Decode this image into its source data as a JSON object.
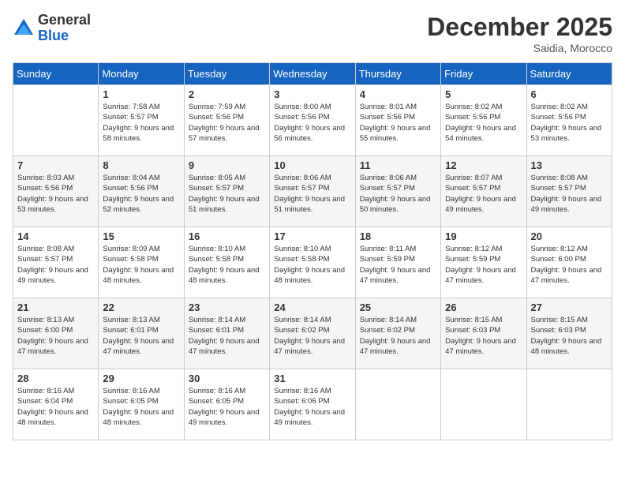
{
  "header": {
    "logo_general": "General",
    "logo_blue": "Blue",
    "month_year": "December 2025",
    "location": "Saidia, Morocco"
  },
  "days_of_week": [
    "Sunday",
    "Monday",
    "Tuesday",
    "Wednesday",
    "Thursday",
    "Friday",
    "Saturday"
  ],
  "weeks": [
    [
      {
        "day": "",
        "sunrise": "",
        "sunset": "",
        "daylight": ""
      },
      {
        "day": "1",
        "sunrise": "Sunrise: 7:58 AM",
        "sunset": "Sunset: 5:57 PM",
        "daylight": "Daylight: 9 hours and 58 minutes."
      },
      {
        "day": "2",
        "sunrise": "Sunrise: 7:59 AM",
        "sunset": "Sunset: 5:56 PM",
        "daylight": "Daylight: 9 hours and 57 minutes."
      },
      {
        "day": "3",
        "sunrise": "Sunrise: 8:00 AM",
        "sunset": "Sunset: 5:56 PM",
        "daylight": "Daylight: 9 hours and 56 minutes."
      },
      {
        "day": "4",
        "sunrise": "Sunrise: 8:01 AM",
        "sunset": "Sunset: 5:56 PM",
        "daylight": "Daylight: 9 hours and 55 minutes."
      },
      {
        "day": "5",
        "sunrise": "Sunrise: 8:02 AM",
        "sunset": "Sunset: 5:56 PM",
        "daylight": "Daylight: 9 hours and 54 minutes."
      },
      {
        "day": "6",
        "sunrise": "Sunrise: 8:02 AM",
        "sunset": "Sunset: 5:56 PM",
        "daylight": "Daylight: 9 hours and 53 minutes."
      }
    ],
    [
      {
        "day": "7",
        "sunrise": "Sunrise: 8:03 AM",
        "sunset": "Sunset: 5:56 PM",
        "daylight": "Daylight: 9 hours and 53 minutes."
      },
      {
        "day": "8",
        "sunrise": "Sunrise: 8:04 AM",
        "sunset": "Sunset: 5:56 PM",
        "daylight": "Daylight: 9 hours and 52 minutes."
      },
      {
        "day": "9",
        "sunrise": "Sunrise: 8:05 AM",
        "sunset": "Sunset: 5:57 PM",
        "daylight": "Daylight: 9 hours and 51 minutes."
      },
      {
        "day": "10",
        "sunrise": "Sunrise: 8:06 AM",
        "sunset": "Sunset: 5:57 PM",
        "daylight": "Daylight: 9 hours and 51 minutes."
      },
      {
        "day": "11",
        "sunrise": "Sunrise: 8:06 AM",
        "sunset": "Sunset: 5:57 PM",
        "daylight": "Daylight: 9 hours and 50 minutes."
      },
      {
        "day": "12",
        "sunrise": "Sunrise: 8:07 AM",
        "sunset": "Sunset: 5:57 PM",
        "daylight": "Daylight: 9 hours and 49 minutes."
      },
      {
        "day": "13",
        "sunrise": "Sunrise: 8:08 AM",
        "sunset": "Sunset: 5:57 PM",
        "daylight": "Daylight: 9 hours and 49 minutes."
      }
    ],
    [
      {
        "day": "14",
        "sunrise": "Sunrise: 8:08 AM",
        "sunset": "Sunset: 5:57 PM",
        "daylight": "Daylight: 9 hours and 49 minutes."
      },
      {
        "day": "15",
        "sunrise": "Sunrise: 8:09 AM",
        "sunset": "Sunset: 5:58 PM",
        "daylight": "Daylight: 9 hours and 48 minutes."
      },
      {
        "day": "16",
        "sunrise": "Sunrise: 8:10 AM",
        "sunset": "Sunset: 5:58 PM",
        "daylight": "Daylight: 9 hours and 48 minutes."
      },
      {
        "day": "17",
        "sunrise": "Sunrise: 8:10 AM",
        "sunset": "Sunset: 5:58 PM",
        "daylight": "Daylight: 9 hours and 48 minutes."
      },
      {
        "day": "18",
        "sunrise": "Sunrise: 8:11 AM",
        "sunset": "Sunset: 5:59 PM",
        "daylight": "Daylight: 9 hours and 47 minutes."
      },
      {
        "day": "19",
        "sunrise": "Sunrise: 8:12 AM",
        "sunset": "Sunset: 5:59 PM",
        "daylight": "Daylight: 9 hours and 47 minutes."
      },
      {
        "day": "20",
        "sunrise": "Sunrise: 8:12 AM",
        "sunset": "Sunset: 6:00 PM",
        "daylight": "Daylight: 9 hours and 47 minutes."
      }
    ],
    [
      {
        "day": "21",
        "sunrise": "Sunrise: 8:13 AM",
        "sunset": "Sunset: 6:00 PM",
        "daylight": "Daylight: 9 hours and 47 minutes."
      },
      {
        "day": "22",
        "sunrise": "Sunrise: 8:13 AM",
        "sunset": "Sunset: 6:01 PM",
        "daylight": "Daylight: 9 hours and 47 minutes."
      },
      {
        "day": "23",
        "sunrise": "Sunrise: 8:14 AM",
        "sunset": "Sunset: 6:01 PM",
        "daylight": "Daylight: 9 hours and 47 minutes."
      },
      {
        "day": "24",
        "sunrise": "Sunrise: 8:14 AM",
        "sunset": "Sunset: 6:02 PM",
        "daylight": "Daylight: 9 hours and 47 minutes."
      },
      {
        "day": "25",
        "sunrise": "Sunrise: 8:14 AM",
        "sunset": "Sunset: 6:02 PM",
        "daylight": "Daylight: 9 hours and 47 minutes."
      },
      {
        "day": "26",
        "sunrise": "Sunrise: 8:15 AM",
        "sunset": "Sunset: 6:03 PM",
        "daylight": "Daylight: 9 hours and 47 minutes."
      },
      {
        "day": "27",
        "sunrise": "Sunrise: 8:15 AM",
        "sunset": "Sunset: 6:03 PM",
        "daylight": "Daylight: 9 hours and 48 minutes."
      }
    ],
    [
      {
        "day": "28",
        "sunrise": "Sunrise: 8:16 AM",
        "sunset": "Sunset: 6:04 PM",
        "daylight": "Daylight: 9 hours and 48 minutes."
      },
      {
        "day": "29",
        "sunrise": "Sunrise: 8:16 AM",
        "sunset": "Sunset: 6:05 PM",
        "daylight": "Daylight: 9 hours and 48 minutes."
      },
      {
        "day": "30",
        "sunrise": "Sunrise: 8:16 AM",
        "sunset": "Sunset: 6:05 PM",
        "daylight": "Daylight: 9 hours and 49 minutes."
      },
      {
        "day": "31",
        "sunrise": "Sunrise: 8:16 AM",
        "sunset": "Sunset: 6:06 PM",
        "daylight": "Daylight: 9 hours and 49 minutes."
      },
      {
        "day": "",
        "sunrise": "",
        "sunset": "",
        "daylight": ""
      },
      {
        "day": "",
        "sunrise": "",
        "sunset": "",
        "daylight": ""
      },
      {
        "day": "",
        "sunrise": "",
        "sunset": "",
        "daylight": ""
      }
    ]
  ]
}
